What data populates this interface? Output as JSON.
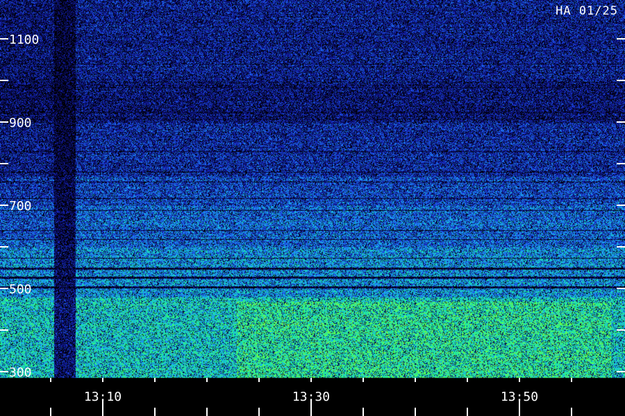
{
  "stamp": "HA 01/25",
  "colors": {
    "background": "#000000",
    "text": "#ffffff",
    "ticks": "#ffffff",
    "colormap": [
      "#000000",
      "#0a0a6e",
      "#1a2fd0",
      "#1e8cff",
      "#14d2c8",
      "#28ff78",
      "#96ff28"
    ]
  },
  "chart_data": {
    "type": "heatmap",
    "title": "",
    "xlabel": "",
    "ylabel": "",
    "x_unit": "time (HH:MM)",
    "xlim": [
      "13:01",
      "13:59"
    ],
    "ylim": [
      300,
      1150
    ],
    "x_ticks_labeled": [
      "13:10",
      "13:30",
      "13:50"
    ],
    "x_minor_tick_step_minutes": 5,
    "y_ticks_labeled": [
      300,
      500,
      700,
      900,
      1100
    ],
    "y_minor_tick_step": 100,
    "grid": false,
    "legend": "none",
    "description_bands": [
      {
        "from": 300,
        "to": 480,
        "intensity": "high"
      },
      {
        "from": 480,
        "to": 600,
        "intensity": "medium-high",
        "note": "dark horizontal lines near 520-540"
      },
      {
        "from": 600,
        "to": 760,
        "intensity": "medium"
      },
      {
        "from": 760,
        "to": 1150,
        "intensity": "low"
      }
    ],
    "data_gap": {
      "from": "13:06",
      "to": "13:08"
    }
  }
}
